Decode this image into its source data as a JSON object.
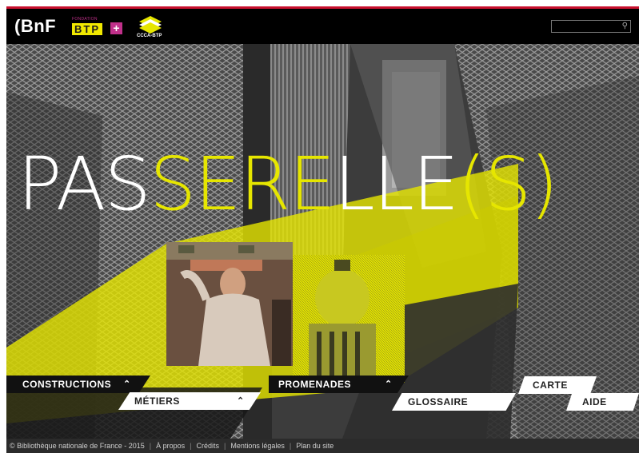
{
  "header": {
    "bnf_logo": "(BnF",
    "btp_logo_small": "FONDATION",
    "btp_logo": "BTP",
    "btp_plus": "+",
    "ccca_logo": "CCCA-BTP",
    "search_placeholder": "",
    "search_icon_glyph": "⚲"
  },
  "hero": {
    "title_white_1": "PAS",
    "title_yellow_1": "SERE",
    "title_white_2": "LLE",
    "title_yellow_2": "(S)"
  },
  "nav": {
    "constructions": "CONSTRUCTIONS",
    "metiers": "MÉTIERS",
    "promenades": "PROMENADES",
    "glossaire": "GLOSSAIRE",
    "carte": "CARTE",
    "aide": "AIDE",
    "chevron": "⌃"
  },
  "footer": {
    "copyright": "© Bibliothèque nationale de France - 2015",
    "links": [
      "À propos",
      "Crédits",
      "Mentions légales",
      "Plan du site"
    ],
    "separator": "|"
  },
  "colors": {
    "accent_yellow": "#e6e600",
    "header_bg": "#000000",
    "top_line": "#c8102e",
    "footer_bg": "#2b2b2b"
  }
}
